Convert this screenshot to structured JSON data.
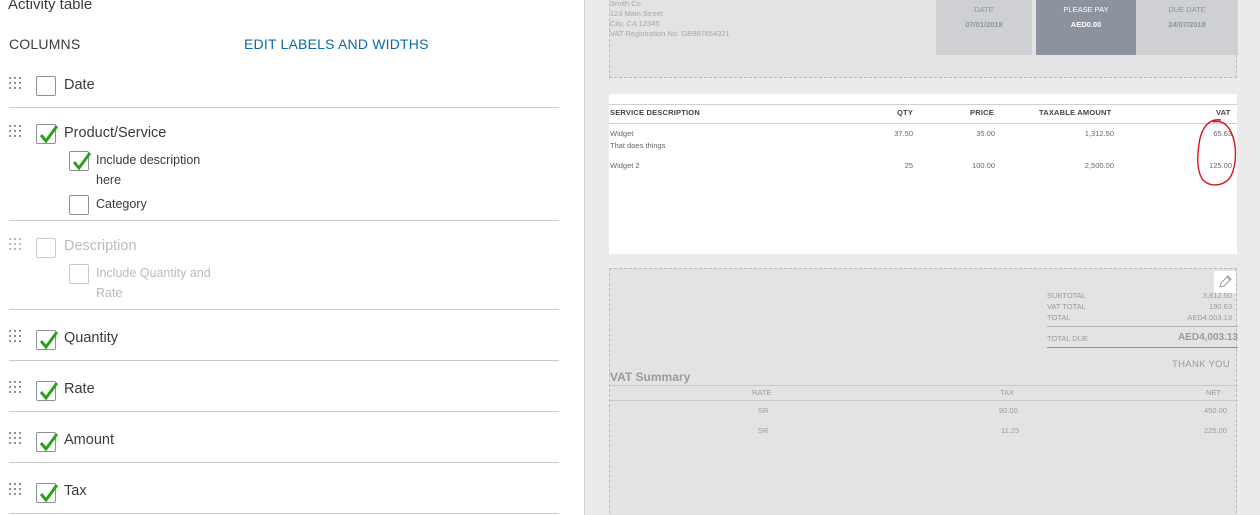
{
  "left": {
    "title": "Activity table",
    "columns_label": "COLUMNS",
    "edit_link": "EDIT LABELS AND WIDTHS",
    "rows": [
      {
        "label": "Date",
        "checked": false
      },
      {
        "label": "Product/Service",
        "checked": true
      },
      {
        "label": "Description",
        "checked": false,
        "disabled": true
      },
      {
        "label": "Quantity",
        "checked": true
      },
      {
        "label": "Rate",
        "checked": true
      },
      {
        "label": "Amount",
        "checked": true
      },
      {
        "label": "Tax",
        "checked": true
      }
    ],
    "sub_options": {
      "include_description_1": "Include description",
      "include_description_2": "here",
      "category": "Category",
      "include_qty_1": "Include Quantity and",
      "include_qty_2": "Rate"
    }
  },
  "invoice": {
    "company": [
      "Smith Co.",
      "123 Main Street",
      "City, CA 12345",
      "VAT Registration No.  GB987654321"
    ],
    "meta": {
      "date_label": "DATE",
      "date_value": "07/01/2018",
      "pay_label": "PLEASE PAY",
      "pay_value": "AED0.00",
      "due_label": "DUE DATE",
      "due_value": "24/07/2018"
    },
    "table": {
      "headers": [
        "SERVICE DESCRIPTION",
        "QTY",
        "PRICE",
        "TAXABLE AMOUNT",
        "VAT"
      ],
      "rows": [
        {
          "desc": "Widget",
          "desc2": "That does things",
          "qty": "37.50",
          "price": "35.00",
          "taxable": "1,312.50",
          "vat": "65.63"
        },
        {
          "desc": "Widget 2",
          "desc2": "",
          "qty": "25",
          "price": "100.00",
          "taxable": "2,500.00",
          "vat": "125.00"
        }
      ]
    },
    "summary": {
      "subtotal_label": "SUBTOTAL",
      "subtotal": "3,812.50",
      "vat_total_label": "VAT TOTAL",
      "vat_total": "190.63",
      "total_label": "TOTAL",
      "total": "AED4,003.13",
      "total_due_label": "TOTAL DUE",
      "total_due": "AED4,003.13",
      "thanks": "THANK YOU"
    },
    "vat_summary": {
      "title": "VAT Summary",
      "headers": [
        "RATE",
        "TAX",
        "NET"
      ],
      "rows": [
        {
          "rate": "SR",
          "tax": "90.00",
          "net": "450.00"
        },
        {
          "rate": "SR",
          "tax": "11.25",
          "net": "225.00"
        }
      ]
    }
  },
  "colors": {
    "check": "#2ca01c",
    "link": "#0d6aa8",
    "annotation": "#d9141c"
  }
}
